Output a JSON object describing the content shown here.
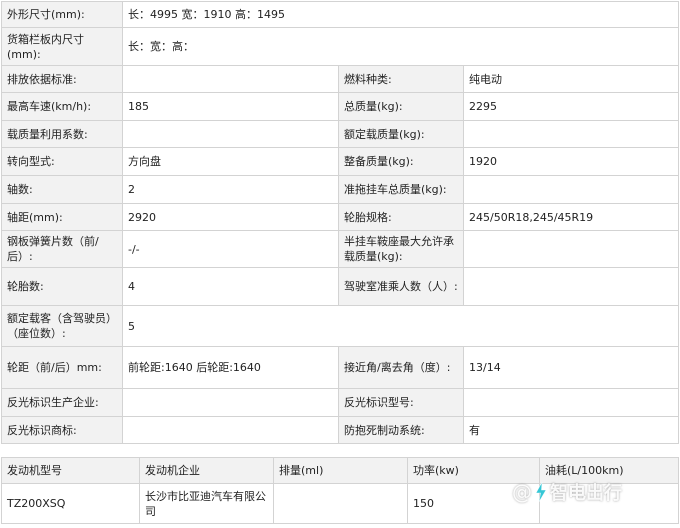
{
  "spec_rows": [
    {
      "l1": "外形尺寸(mm):",
      "v1": "长：4995 宽：1910 高：1495"
    },
    {
      "l1": "货箱栏板内尺寸(mm):",
      "v1": "长：宽：高："
    },
    {
      "l1": "排放依据标准:",
      "v1": "",
      "l2": "燃料种类:",
      "v2": "纯电动"
    },
    {
      "l1": "最高车速(km/h):",
      "v1": "185",
      "l2": "总质量(kg):",
      "v2": "2295"
    },
    {
      "l1": "载质量利用系数:",
      "v1": "",
      "l2": "额定载质量(kg):",
      "v2": ""
    },
    {
      "l1": "转向型式:",
      "v1": "方向盘",
      "l2": "整备质量(kg):",
      "v2": "1920"
    },
    {
      "l1": "轴数:",
      "v1": "2",
      "l2": "准拖挂车总质量(kg):",
      "v2": ""
    },
    {
      "l1": "轴距(mm):",
      "v1": "2920",
      "l2": "轮胎规格:",
      "v2": "245/50R18,245/45R19"
    },
    {
      "l1": "钢板弹簧片数（前/后）:",
      "v1": "-/-",
      "l2": "半挂车鞍座最大允许承载质量(kg):",
      "v2": ""
    },
    {
      "l1": "轮胎数:",
      "v1": "4",
      "l2": "驾驶室准乘人数（人）:",
      "v2": ""
    },
    {
      "l1": "额定载客（含驾驶员）（座位数）:",
      "v1": "5"
    },
    {
      "l1": "轮距（前/后）mm:",
      "v1": "前轮距:1640 后轮距:1640",
      "l2": "接近角/离去角（度）:",
      "v2": "13/14"
    },
    {
      "l1": "反光标识生产企业:",
      "v1": "",
      "l2": "反光标识型号:",
      "v2": ""
    },
    {
      "l1": "反光标识商标:",
      "v1": "",
      "l2": "防抱死制动系统:",
      "v2": "有"
    }
  ],
  "engine_table": {
    "headers": [
      "发动机型号",
      "发动机企业",
      "排量(ml)",
      "功率(kw)",
      "油耗(L/100km)"
    ],
    "row": [
      "TZ200XSQ",
      "长沙市比亚迪汽车有限公司",
      "",
      "150",
      ""
    ]
  },
  "watermark": {
    "symbol": "@",
    "text": "智电出行",
    "icon": "lightning-icon"
  }
}
